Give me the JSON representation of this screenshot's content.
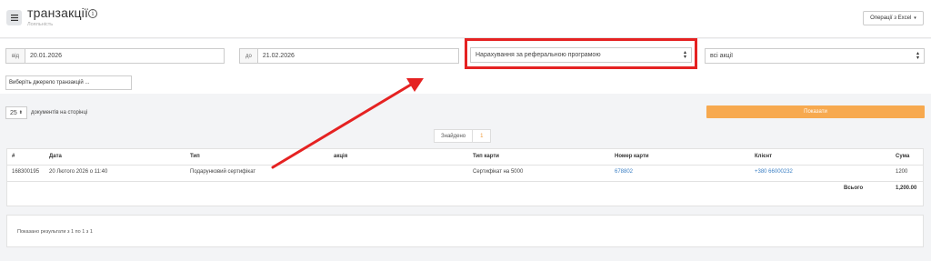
{
  "header": {
    "title": "транзакції",
    "subtitle": "Лояльність",
    "menu_icon": "menu-icon",
    "info_icon_glyph": "i",
    "operations_button": "Операції з Excel",
    "operations_caret": "▾"
  },
  "filters": {
    "from_label": "від",
    "from_value": "20.01.2026",
    "to_label": "до",
    "to_value": "21.02.2026",
    "type_select": "Нарахування за реферальною програмою",
    "action_select": "всі акції",
    "source_button": "Виберіть джерело транзакцій ..."
  },
  "paging": {
    "per_page_value": "25",
    "per_page_label": "документів на сторінці",
    "show_button": "Показати"
  },
  "found": {
    "label": "Знайдено",
    "count": "1"
  },
  "table": {
    "headers": [
      "#",
      "Дата",
      "Тип",
      "акція",
      "Тип карти",
      "Номер карти",
      "Клієнт",
      "Сума"
    ],
    "rows": [
      {
        "id": "168300195",
        "date": "20 Лютого 2026 о 11:40",
        "type": "Подарунковий сертифікат",
        "action": "",
        "card_type": "Сертифікат на 5000",
        "card_number": "678802",
        "client": "+380 66000232",
        "amount": "1200"
      }
    ],
    "total_label": "Всього",
    "total_value": "1,200.00"
  },
  "footer": {
    "results_text": "Показано результати з 1 по 1 з 1"
  },
  "colors": {
    "accent": "#f7a94f",
    "highlight": "#e52222",
    "link": "#3b7fc4"
  }
}
